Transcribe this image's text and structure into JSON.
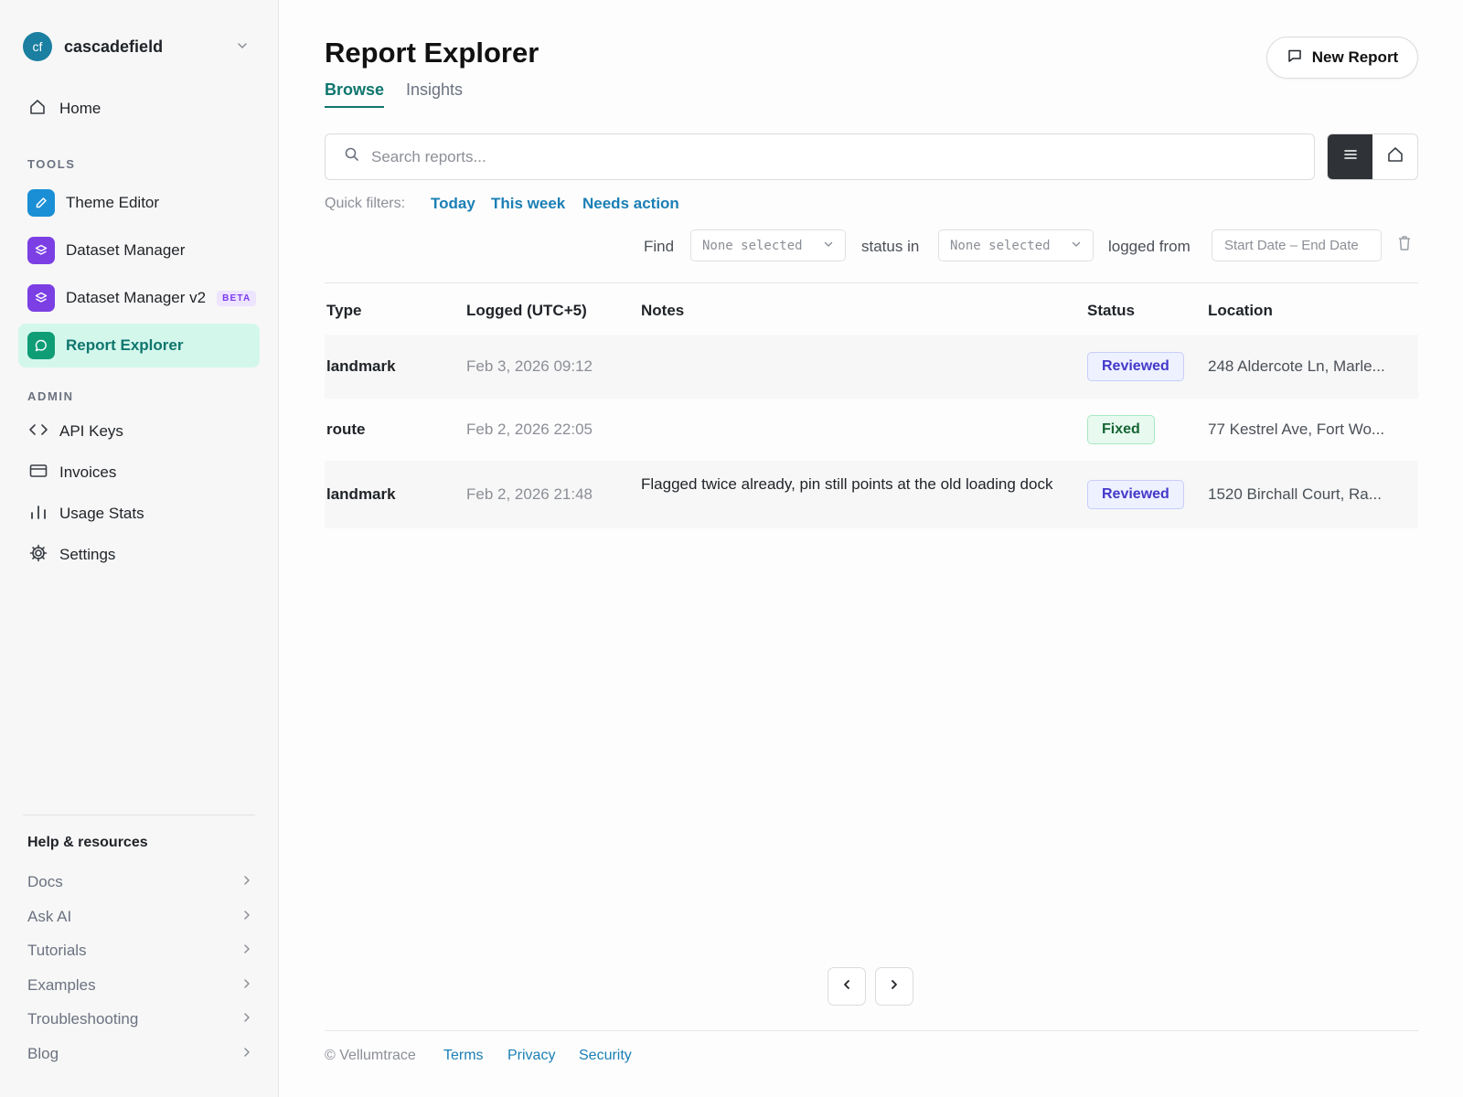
{
  "workspace": {
    "initials": "cf",
    "name": "cascadefield"
  },
  "sidebar": {
    "home": "Home",
    "tools_label": "TOOLS",
    "tools": [
      {
        "label": "Theme Editor",
        "color": "#1a8fd6",
        "icon": "pencil-icon"
      },
      {
        "label": "Dataset Manager",
        "color": "#7b3fe4",
        "icon": "layers-icon"
      },
      {
        "label": "Dataset Manager v2",
        "color": "#7b3fe4",
        "icon": "layers-icon",
        "badge": "BETA"
      },
      {
        "label": "Report Explorer",
        "color": "#0f9d76",
        "icon": "message-icon",
        "active": true
      }
    ],
    "admin_label": "ADMIN",
    "admin": [
      {
        "label": "API Keys",
        "icon": "code-icon"
      },
      {
        "label": "Invoices",
        "icon": "card-icon"
      },
      {
        "label": "Usage Stats",
        "icon": "bar-chart-icon"
      },
      {
        "label": "Settings",
        "icon": "gear-icon"
      }
    ],
    "help_title": "Help & resources",
    "help": [
      "Docs",
      "Ask AI",
      "Tutorials",
      "Examples",
      "Troubleshooting",
      "Blog"
    ]
  },
  "header": {
    "title": "Report Explorer",
    "tabs": [
      "Browse",
      "Insights"
    ],
    "active_tab": "Browse",
    "new_report_label": "New Report"
  },
  "search": {
    "placeholder": "Search reports...",
    "value": ""
  },
  "quick_filters": {
    "label": "Quick filters:",
    "items": [
      "Today",
      "This week",
      "Needs action"
    ]
  },
  "filters": {
    "find_label": "Find",
    "type_value": "None selected",
    "status_label": "status in",
    "status_value": "None selected",
    "logged_label": "logged from",
    "date_range": "Start Date – End Date"
  },
  "table": {
    "columns": [
      "Type",
      "Logged (UTC+5)",
      "Notes",
      "Status",
      "Location"
    ],
    "rows": [
      {
        "type": "landmark",
        "logged": "Feb 3, 2026 09:12",
        "notes": "",
        "status": "Reviewed",
        "location": "248 Aldercote Ln, Marle..."
      },
      {
        "type": "route",
        "logged": "Feb 2, 2026 22:05",
        "notes": "",
        "status": "Fixed",
        "location": "77 Kestrel Ave, Fort Wo..."
      },
      {
        "type": "landmark",
        "logged": "Feb 2, 2026 21:48",
        "notes": "Flagged twice already, pin still points at the old loading dock",
        "status": "Reviewed",
        "location": "1520 Birchall Court, Ra..."
      }
    ]
  },
  "footer": {
    "copyright": "© Vellumtrace",
    "links": [
      "Terms",
      "Privacy",
      "Security"
    ]
  },
  "colors": {
    "accent": "#0f766e",
    "link": "#1a7fb5",
    "active_bg": "#d4f7ec",
    "reviewed": "#4338ca",
    "fixed": "#166534"
  }
}
